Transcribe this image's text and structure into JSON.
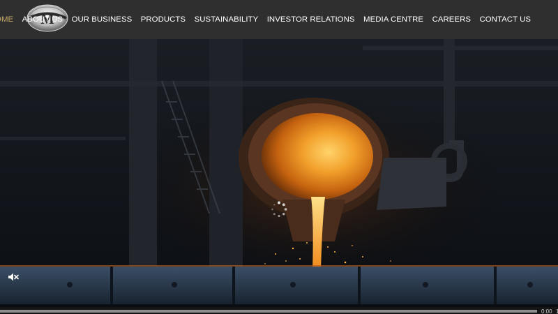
{
  "brand": {
    "logo_letter": "M",
    "logo_label": "company-logo"
  },
  "nav": {
    "items": [
      {
        "label": "HOME",
        "active": true
      },
      {
        "label": "ABOUT US",
        "active": false
      },
      {
        "label": "OUR BUSINESS",
        "active": false
      },
      {
        "label": "PRODUCTS",
        "active": false
      },
      {
        "label": "SUSTAINABILITY",
        "active": false
      },
      {
        "label": "INVESTOR RELATIONS",
        "active": false
      },
      {
        "label": "MEDIA CENTRE",
        "active": false
      },
      {
        "label": "CAREERS",
        "active": false
      },
      {
        "label": "CONTACT US",
        "active": false
      }
    ]
  },
  "video": {
    "state": "loading",
    "muted": true,
    "progress": 0,
    "time": "0:00",
    "volume_label": "1"
  },
  "icons": {
    "spinner": "loading-spinner-icon",
    "mute": "speaker-muted-icon"
  },
  "colors": {
    "header_bg": "#2f2f2f",
    "nav_text": "#ffffff",
    "nav_active": "#c9a76b",
    "molten": "#f08a1c"
  }
}
